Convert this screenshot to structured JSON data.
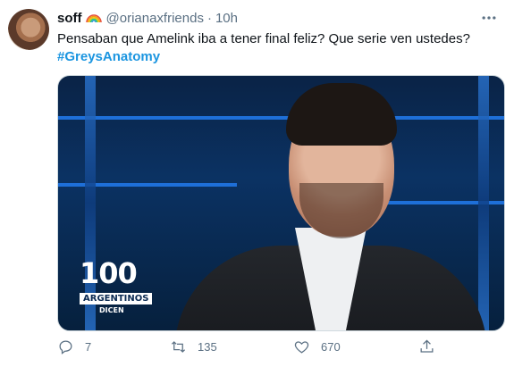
{
  "tweet": {
    "author": {
      "name": "soff",
      "badge_icon": "rainbow-icon",
      "handle": "@orianaxfriends",
      "separator": "·",
      "time": "10h"
    },
    "text": "Pensaban que Amelink iba a tener final feliz? Que serie ven ustedes?",
    "hashtag": "#GreysAnatomy",
    "media": {
      "logo_number": "100",
      "logo_label": "ARGENTINOS",
      "logo_sub": "DICEN"
    },
    "actions": {
      "reply": {
        "icon": "reply-icon",
        "count": "7"
      },
      "retweet": {
        "icon": "retweet-icon",
        "count": "135"
      },
      "like": {
        "icon": "heart-icon",
        "count": "670"
      },
      "share": {
        "icon": "share-icon"
      }
    },
    "colors": {
      "hashtag": "#1b95e0",
      "muted": "#5b7083"
    }
  }
}
